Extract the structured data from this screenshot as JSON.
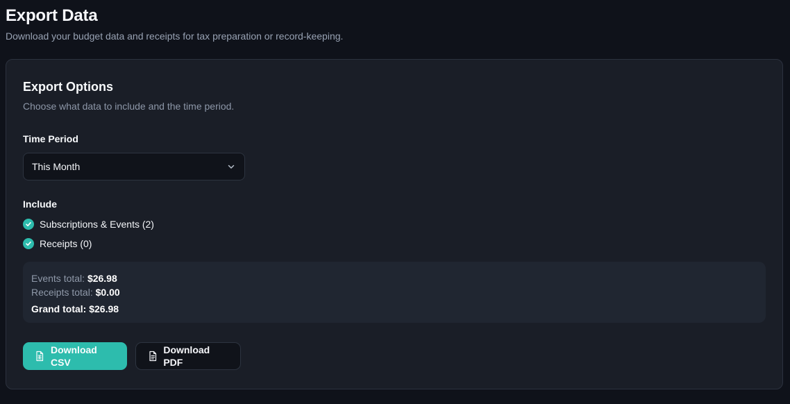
{
  "header": {
    "title": "Export Data",
    "subtitle": "Download your budget data and receipts for tax preparation or record-keeping."
  },
  "card": {
    "title": "Export Options",
    "subtitle": "Choose what data to include and the time period."
  },
  "time_period": {
    "label": "Time Period",
    "selected": "This Month"
  },
  "include": {
    "label": "Include",
    "options": [
      {
        "label": "Subscriptions & Events (2)",
        "checked": true
      },
      {
        "label": "Receipts (0)",
        "checked": true
      }
    ]
  },
  "summary": {
    "events_label": "Events total:",
    "events_value": "$26.98",
    "receipts_label": "Receipts total:",
    "receipts_value": "$0.00",
    "grand_label": "Grand total:",
    "grand_value": "$26.98"
  },
  "actions": {
    "download_csv": "Download CSV",
    "download_pdf": "Download PDF"
  },
  "icons": {
    "chevron": "chevron-down-icon",
    "check": "check-circle-icon",
    "csv": "spreadsheet-file-icon",
    "pdf": "file-text-icon"
  },
  "colors": {
    "background": "#0f121a",
    "card": "#1a1e27",
    "summary": "#202631",
    "accent": "#2dbcad",
    "text": "#f4f6f9",
    "muted": "#8f99a9",
    "border": "#2d3440"
  }
}
